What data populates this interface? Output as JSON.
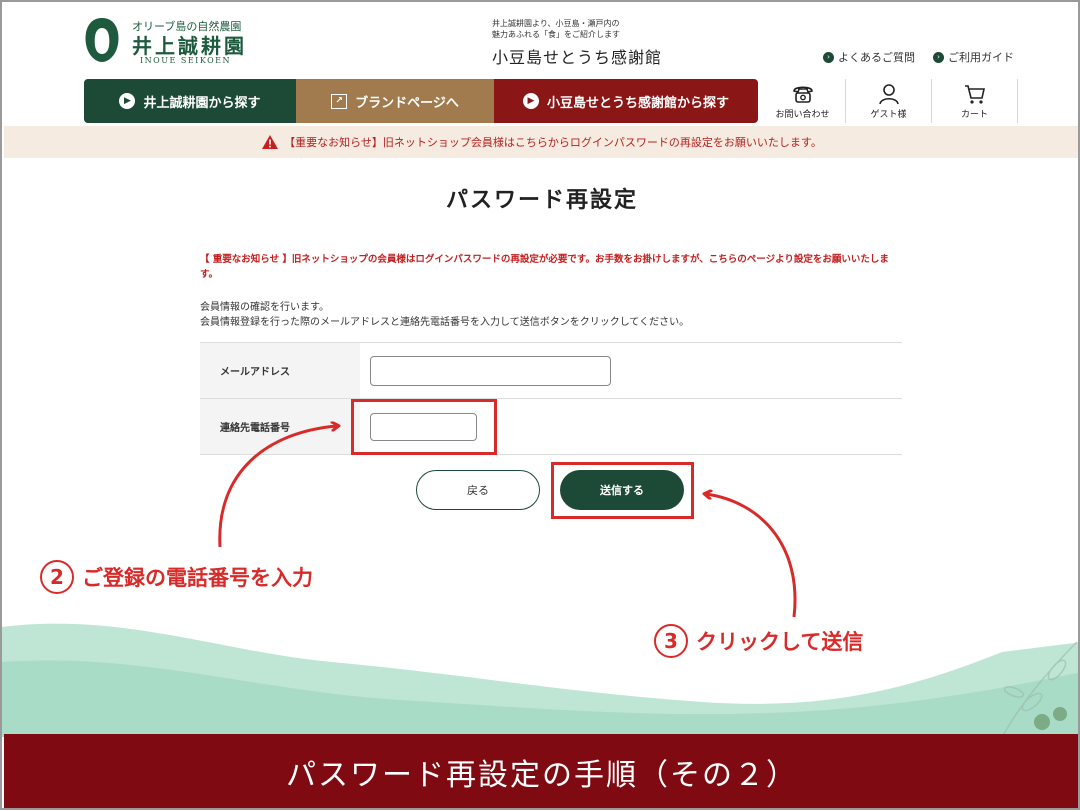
{
  "logo": {
    "sub": "オリーブ島の自然農園",
    "main": "井上誠耕園",
    "en": "INOUE SEIKOEN"
  },
  "header": {
    "tagline_1": "井上誠耕園より、小豆島・瀬戸内の",
    "tagline_2": "魅力あふれる「食」をご紹介します",
    "brand": "小豆島せとうち感謝館",
    "faq_label": "よくあるご質問",
    "guide_label": "ご利用ガイド"
  },
  "nav": {
    "inoue_label": "井上誠耕園から探す",
    "brand_label": "ブランドページへ",
    "shodoshima_label": "小豆島せとうち感謝館から探す",
    "contact_label": "お問い合わせ",
    "guest_label": "ゲスト様",
    "cart_label": "カート"
  },
  "notice": {
    "text": "【重要なお知らせ】旧ネットショップ会員様はこちらからログインパスワードの再設定をお願いいたします。"
  },
  "main": {
    "title": "パスワード再設定",
    "red_note": "【 重要なお知らせ 】旧ネットショップの会員様はログインパスワードの再設定が必要です。お手数をお掛けしますが、こちらのページより設定をお願いいたします。",
    "desc_1": "会員情報の確認を行います。",
    "desc_2": "会員情報登録を行った際のメールアドレスと連絡先電話番号を入力して送信ボタンをクリックしてください。",
    "email_label": "メールアドレス",
    "phone_label": "連絡先電話番号",
    "email_value": "",
    "phone_value": "",
    "back_label": "戻る",
    "submit_label": "送信する"
  },
  "annotations": {
    "step2_num": "2",
    "step2_text": "ご登録の電話番号を入力",
    "step3_num": "3",
    "step3_text": "クリックして送信"
  },
  "caption": "パスワード再設定の手順（その２）",
  "colors": {
    "green": "#1d4a36",
    "brown": "#a17b4e",
    "maroon": "#8a1616",
    "caption_bg": "#7f0a12",
    "annotation_red": "#d92a2a",
    "mint": "#a9dcc6"
  }
}
